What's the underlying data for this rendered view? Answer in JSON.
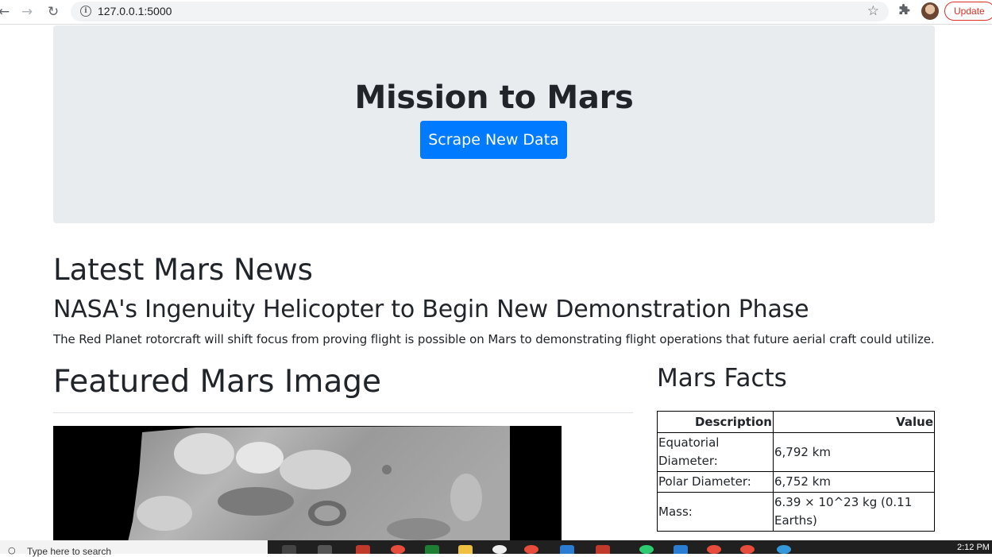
{
  "browser": {
    "url": "127.0.0.1:5000",
    "update_label": "Update"
  },
  "jumbotron": {
    "title": "Mission to Mars",
    "button_label": "Scrape New Data"
  },
  "news": {
    "heading": "Latest Mars News",
    "title": "NASA's Ingenuity Helicopter to Begin New Demonstration Phase",
    "paragraph": "The Red Planet rotorcraft will shift focus from proving flight is possible on Mars to demonstrating flight operations that future aerial craft could utilize."
  },
  "featured": {
    "heading": "Featured Mars Image"
  },
  "facts": {
    "heading": "Mars Facts",
    "columns": [
      "Description",
      "Value"
    ],
    "rows": [
      [
        "Equatorial Diameter:",
        "6,792 km"
      ],
      [
        "Polar Diameter:",
        "6,752 km"
      ],
      [
        "Mass:",
        "6.39 × 10^23 kg (0.11 Earths)"
      ]
    ]
  },
  "taskbar": {
    "search_placeholder": "Type here to search",
    "clock": "2:12 PM"
  },
  "colors": {
    "primary": "#007bff",
    "jumbotron_bg": "#e9ecef",
    "text": "#212529"
  }
}
